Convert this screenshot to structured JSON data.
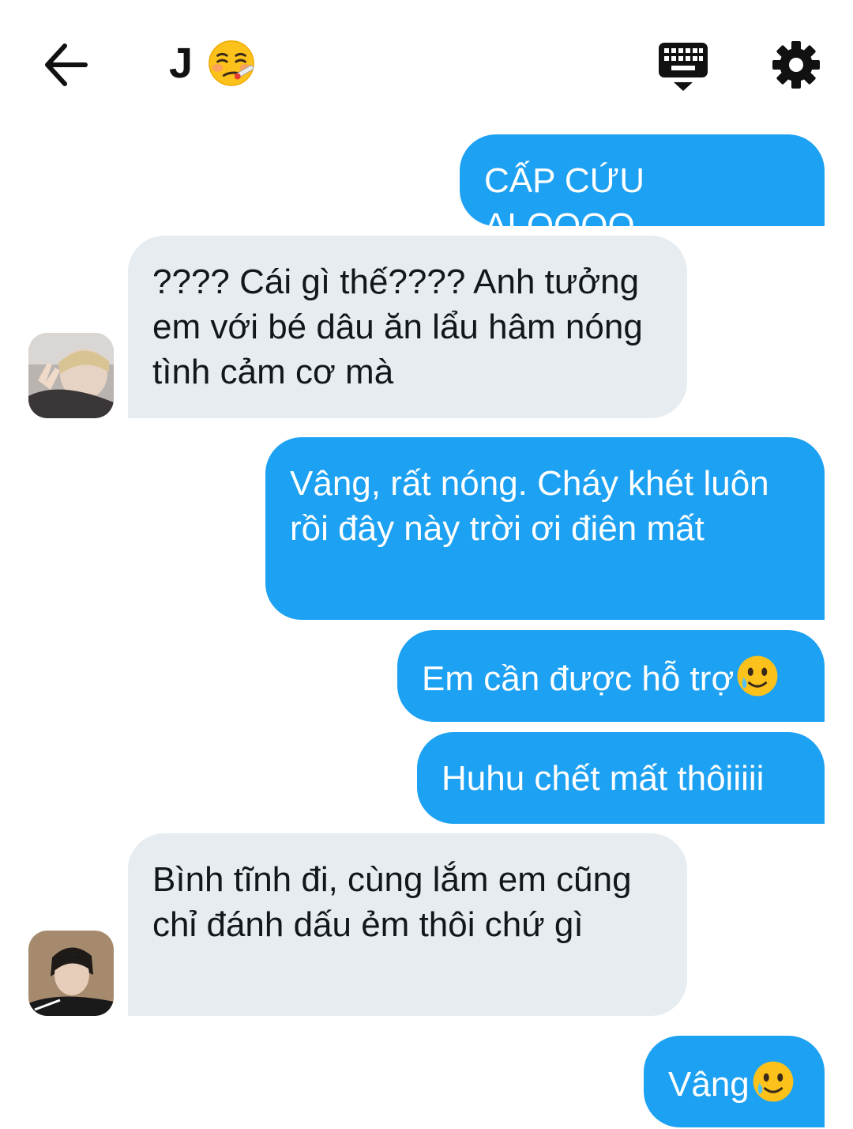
{
  "header": {
    "title": "J",
    "title_emoji": "face-with-thermometer-icon",
    "back_icon": "arrow-left-icon",
    "keyboard_icon": "keyboard-icon",
    "settings_icon": "gear-icon"
  },
  "colors": {
    "outgoing_bubble": "#1da1f2",
    "incoming_bubble": "#e6ecf0",
    "icon": "#111111"
  },
  "messages": [
    {
      "direction": "out",
      "text": "CẤP CỨU ALOOOO"
    },
    {
      "direction": "in",
      "text": "???? Cái gì thế???? Anh tưởng em với bé dâu ăn lẩu hâm nóng tình cảm cơ mà",
      "avatar": "avatar-photo-1"
    },
    {
      "direction": "out",
      "text": "Vâng, rất nóng. Cháy khét luôn rồi đây này trời ơi điên mất"
    },
    {
      "direction": "out",
      "text": "Em cần được hỗ trợ",
      "emoji": "smiling-face-with-tear-icon"
    },
    {
      "direction": "out",
      "text": "Huhu chết mất thôiiiii"
    },
    {
      "direction": "in",
      "text": "Bình tĩnh đi, cùng lắm em cũng chỉ đánh dấu ẻm thôi chứ gì",
      "avatar": "avatar-photo-2"
    },
    {
      "direction": "out",
      "text": "Vâng",
      "emoji": "smiling-face-with-tear-icon"
    }
  ]
}
